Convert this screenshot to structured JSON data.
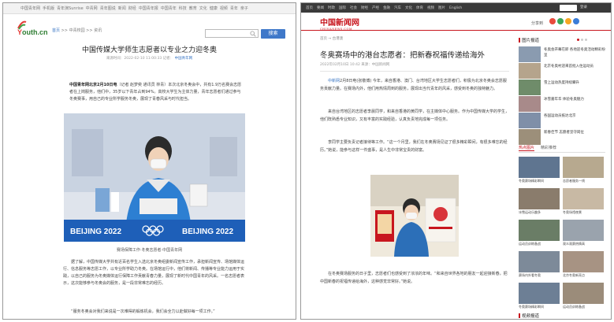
{
  "left": {
    "nav_links": [
      "中国青年网",
      "手机版",
      "青年演Sunrise",
      "中青网",
      "青年图说",
      "新闻",
      "财经",
      "中国青年报",
      "中国青年",
      "科技",
      "教育",
      "文化",
      "健康",
      "视频",
      "青年",
      "亲子"
    ],
    "logo": {
      "text_a": "outh",
      "text_b": ".cn",
      "text_prefix": "Y"
    },
    "breadcrumb": {
      "home": "首页",
      "sep": ">>",
      "path": "中青校园 >> 资讯"
    },
    "search": {
      "placeholder": "",
      "button": "搜索"
    },
    "article": {
      "title": "中国传媒大学师生志愿者以专业之力迎冬奥",
      "meta_date": "来源时间：2022-02-10 11:00:33 记者：",
      "meta_source": "中国青年网",
      "p1_lead": "中国青年网北京2月10日电",
      "p1_rest": "（记者 赵梦奕 通讯员 林青）本次北京冬奥会中，共有1.9万名赛会志愿者在上岗服务，他们中，35岁以下青年占到94%。高校大学生为主体力量，青年志愿者们通过参与冬奥赛事，用自己的专业所学服务冬奥，展现了青春风采与时代担当。",
      "caption": "赛场保障工作·冬奥志愿者·中国青年网",
      "p2": "据了解，中国传媒大学共有近百名学生入选北京冬奥组委新闻宣传工作，承担新闻宣传、场馆媒体运行、信息服务等志愿工作，以专业所学助力冬奥。在场馆运行中，他们将新闻、传播等专业能力运用于实践，以自己的服务为冬奥媒体运行保障工作贡献青春力量，展现了新时代中国青年的风采。一名志愿者表示，这次能够参与冬奥会的服务，是一段非常难忘的经历。",
      "p3": "“服务冬奥会对我们来说是一次难得的锻炼机会，我们会全力以赴做好每一项工作。”"
    }
  },
  "right": {
    "topbar_links": [
      "首页",
      "要闻",
      "时政",
      "国际",
      "社会",
      "财经",
      "产经",
      "金融",
      "汽车",
      "文化",
      "体育",
      "视频",
      "图片",
      "English"
    ],
    "top_login": "登录",
    "logo": {
      "main": "中国新闻网",
      "sub": "CHINANEWS.COM"
    },
    "share_label": "分享到",
    "share_colors": [
      "#e94b3c",
      "#3aa757",
      "#f5a623",
      "#3b7dd8"
    ],
    "breadcrumb": "首页 → 台港澳",
    "article": {
      "title": "冬奥赛场中的港台志愿者：把新春祝福传递给海外",
      "meta": "2022年02月10日 10:42    来源：中国新闻网",
      "p1_src": "中新网",
      "p1": "2月8日电(张敬博) 今年，来自香港、澳门、台湾地区大学生志愿者们，积极为北京冬奥会志愿服务贡献力量。在赛场内外，他们用热情周到的服务，展现出当代青年的风采，感受到冬奥的独特魅力。",
      "p2": "来自台湾地区的志愿者李晨同学，和来自香港的黄同学，在主媒体中心服务。作为中国传媒大学的学生，他们既熟悉专业知识，又有丰富的实践经验，认真负责地完成每一项任务。",
      "p3": "李同学主要负责记者接待等工作。“这一个月里，我们在冬奥赛场见证了很多精彩瞬间，有很多难忘的经历。”她说，能参与这样一件盛事，是人生中非常宝贵的财富。",
      "p5": "在冬奥赛场服务的日子里，志愿者们也感受到了浓浓的年味。“和来自世界各地的朋友一起迎接新春，把中国新春的祝福传递给海外，这种感觉非常好。”她说。"
    },
    "sidebar": {
      "heading_top": "图片报道",
      "news": [
        {
          "title": "冬奥会开幕在即 各地迎冬奥活动精彩纷呈"
        },
        {
          "title": "北京冬奥村迎来首批入住运动员"
        },
        {
          "title": "雪上运动热度持续攀升"
        },
        {
          "title": "冰雪嘉年华 体验冬奥魅力"
        },
        {
          "title": "各国运动员抵达北京"
        },
        {
          "title": "新春佳节 志愿者坚守岗位"
        }
      ],
      "tab_a": "热点图片",
      "tab_b": "精彩推荐",
      "grid": [
        {
          "caption": "冬奥赛场精彩瞬间"
        },
        {
          "caption": "志愿者服务一线"
        },
        {
          "caption": "冰雪运动乐趣多"
        },
        {
          "caption": "冬奥场馆夜景"
        },
        {
          "caption": "运动员训练备战"
        },
        {
          "caption": "观众观赛热情高"
        },
        {
          "caption": "赛场内外看冬奥"
        },
        {
          "caption": "北京冬奥新亮点"
        },
        {
          "caption": "冬奥赛场精彩瞬间"
        },
        {
          "caption": "运动员训练备战"
        }
      ],
      "heading_bottom": "视频报道"
    }
  },
  "photo_left": {
    "banner_text": "BEIJING 2022",
    "banner_text_2": "BEIJING 2022"
  }
}
